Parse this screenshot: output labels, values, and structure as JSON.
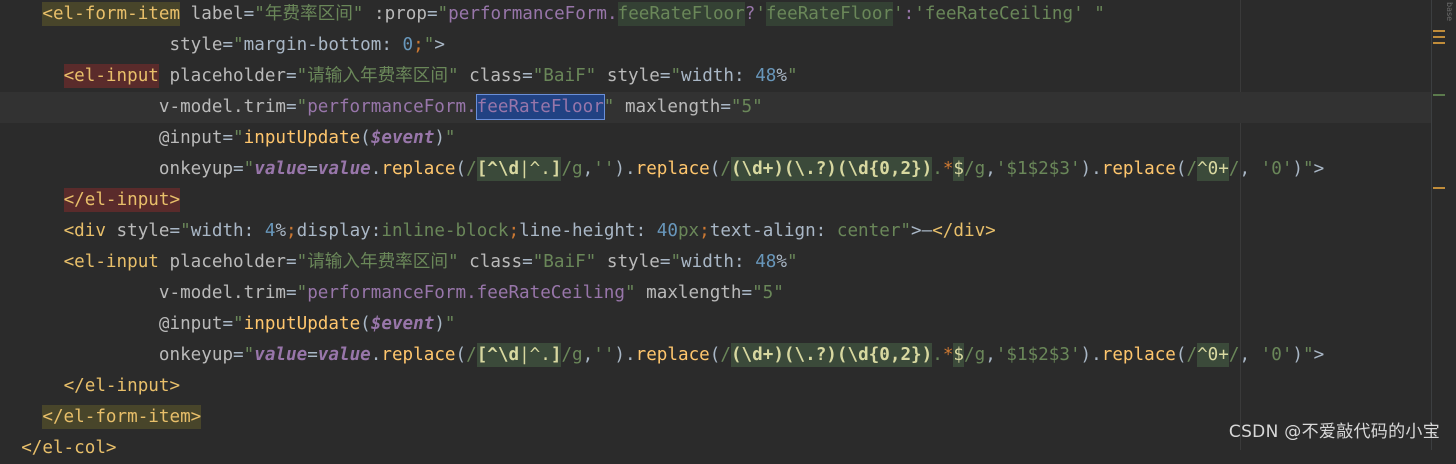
{
  "code_lines": [
    {
      "current": false,
      "tokens": [
        [
          "plain",
          "    "
        ],
        [
          "tag-o",
          "<el-form-item"
        ],
        [
          "plain",
          " "
        ],
        [
          "attr",
          "label"
        ],
        [
          "plain",
          "="
        ],
        [
          "str",
          "\"年费率区间\""
        ],
        [
          "plain",
          " "
        ],
        [
          "attr",
          ":prop"
        ],
        [
          "plain",
          "="
        ],
        [
          "str",
          "\""
        ],
        [
          "vue",
          "performanceForm."
        ],
        [
          "hl",
          "feeRateFloor"
        ],
        [
          "vue",
          "?"
        ],
        [
          "str",
          "'"
        ],
        [
          "hl",
          "feeRateFloor"
        ],
        [
          "str",
          "'"
        ],
        [
          "vue",
          ":"
        ],
        [
          "str",
          "'feeRateCeiling'"
        ],
        [
          "plain",
          " "
        ],
        [
          "str",
          "\""
        ]
      ]
    },
    {
      "current": false,
      "tokens": [
        [
          "plain",
          "                "
        ],
        [
          "attr",
          "style"
        ],
        [
          "plain",
          "="
        ],
        [
          "str",
          "\""
        ],
        [
          "plain",
          "margin-bottom: "
        ],
        [
          "num",
          "0"
        ],
        [
          "kw",
          ";"
        ],
        [
          "str",
          "\""
        ],
        [
          "plain",
          ">"
        ]
      ]
    },
    {
      "current": false,
      "tokens": [
        [
          "plain",
          "      "
        ],
        [
          "tag-err",
          "<el-input"
        ],
        [
          "plain",
          " "
        ],
        [
          "attr",
          "placeholder"
        ],
        [
          "plain",
          "="
        ],
        [
          "str",
          "\"请输入年费率区间\""
        ],
        [
          "plain",
          " "
        ],
        [
          "attr",
          "class"
        ],
        [
          "plain",
          "="
        ],
        [
          "str",
          "\"BaiF\""
        ],
        [
          "plain",
          " "
        ],
        [
          "attr",
          "style"
        ],
        [
          "plain",
          "="
        ],
        [
          "str",
          "\""
        ],
        [
          "plain",
          "width: "
        ],
        [
          "num",
          "48"
        ],
        [
          "plain",
          "%"
        ],
        [
          "str",
          "\""
        ]
      ]
    },
    {
      "current": true,
      "tokens": [
        [
          "plain",
          "               "
        ],
        [
          "attr",
          "v-model.trim"
        ],
        [
          "plain",
          "="
        ],
        [
          "str",
          "\""
        ],
        [
          "vue",
          "performanceForm."
        ],
        [
          "sel",
          "feeRateFloor"
        ],
        [
          "str",
          "\""
        ],
        [
          "plain",
          " "
        ],
        [
          "attr",
          "maxlength"
        ],
        [
          "plain",
          "="
        ],
        [
          "str",
          "\"5\""
        ]
      ]
    },
    {
      "current": false,
      "tokens": [
        [
          "plain",
          "               "
        ],
        [
          "attr",
          "@input"
        ],
        [
          "plain",
          "="
        ],
        [
          "str",
          "\""
        ],
        [
          "fn",
          "inputUpdate"
        ],
        [
          "plain",
          "("
        ],
        [
          "ital",
          "$event"
        ],
        [
          "plain",
          ")"
        ],
        [
          "str",
          "\""
        ]
      ]
    },
    {
      "current": false,
      "tokens": [
        [
          "plain",
          "               "
        ],
        [
          "attr",
          "onkeyup"
        ],
        [
          "plain",
          "="
        ],
        [
          "str",
          "\""
        ],
        [
          "ital",
          "value"
        ],
        [
          "plain",
          "="
        ],
        [
          "ital",
          "value"
        ],
        [
          "plain",
          "."
        ],
        [
          "fn",
          "replace"
        ],
        [
          "plain",
          "("
        ],
        [
          "rx",
          "/"
        ],
        [
          "rxb",
          "[^\\d"
        ],
        [
          "rxg",
          "|^."
        ],
        [
          "rxb",
          "]"
        ],
        [
          "rx",
          "/g"
        ],
        [
          "plain",
          ","
        ],
        [
          "str",
          "''"
        ],
        [
          "plain",
          ")."
        ],
        [
          "fn",
          "replace"
        ],
        [
          "plain",
          "("
        ],
        [
          "rx",
          "/"
        ],
        [
          "rxb",
          "(\\d+)"
        ],
        [
          "rxb",
          "(\\.?)"
        ],
        [
          "rxb",
          "(\\d{0,2})"
        ],
        [
          "rx",
          "."
        ],
        [
          "esc",
          "*"
        ],
        [
          "rxg",
          "$"
        ],
        [
          "rx",
          "/g"
        ],
        [
          "plain",
          ","
        ],
        [
          "str",
          "'$1$2$3'"
        ],
        [
          "plain",
          ")."
        ],
        [
          "fn",
          "replace"
        ],
        [
          "plain",
          "("
        ],
        [
          "rx",
          "/"
        ],
        [
          "rxg",
          "^0+"
        ],
        [
          "rx",
          "/"
        ],
        [
          "plain",
          ", "
        ],
        [
          "str",
          "'0'"
        ],
        [
          "plain",
          ")"
        ],
        [
          "str",
          "\""
        ],
        [
          "plain",
          ">"
        ]
      ]
    },
    {
      "current": false,
      "tokens": [
        [
          "plain",
          "      "
        ],
        [
          "tag-err",
          "</el-input>"
        ]
      ]
    },
    {
      "current": false,
      "tokens": [
        [
          "plain",
          "      "
        ],
        [
          "tag",
          "<div"
        ],
        [
          "plain",
          " "
        ],
        [
          "attr",
          "style"
        ],
        [
          "plain",
          "="
        ],
        [
          "str",
          "\""
        ],
        [
          "plain",
          "width: "
        ],
        [
          "num",
          "4"
        ],
        [
          "plain",
          "%"
        ],
        [
          "kw",
          ";"
        ],
        [
          "plain",
          "display:"
        ],
        [
          "str",
          "inline-block"
        ],
        [
          "kw",
          ";"
        ],
        [
          "plain",
          "line-height: "
        ],
        [
          "num",
          "40"
        ],
        [
          "str",
          "px"
        ],
        [
          "kw",
          ";"
        ],
        [
          "plain",
          "text-align: "
        ],
        [
          "str",
          "center"
        ],
        [
          "str",
          "\""
        ],
        [
          "plain",
          ">—"
        ],
        [
          "tag",
          "</div>"
        ]
      ]
    },
    {
      "current": false,
      "tokens": [
        [
          "plain",
          "      "
        ],
        [
          "tag",
          "<el-input"
        ],
        [
          "plain",
          " "
        ],
        [
          "attr",
          "placeholder"
        ],
        [
          "plain",
          "="
        ],
        [
          "str",
          "\"请输入年费率区间\""
        ],
        [
          "plain",
          " "
        ],
        [
          "attr",
          "class"
        ],
        [
          "plain",
          "="
        ],
        [
          "str",
          "\"BaiF\""
        ],
        [
          "plain",
          " "
        ],
        [
          "attr",
          "style"
        ],
        [
          "plain",
          "="
        ],
        [
          "str",
          "\""
        ],
        [
          "plain",
          "width: "
        ],
        [
          "num",
          "48"
        ],
        [
          "plain",
          "%"
        ],
        [
          "str",
          "\""
        ]
      ]
    },
    {
      "current": false,
      "tokens": [
        [
          "plain",
          "               "
        ],
        [
          "attr",
          "v-model.trim"
        ],
        [
          "plain",
          "="
        ],
        [
          "str",
          "\""
        ],
        [
          "vue",
          "performanceForm.feeRateCeiling"
        ],
        [
          "str",
          "\""
        ],
        [
          "plain",
          " "
        ],
        [
          "attr",
          "maxlength"
        ],
        [
          "plain",
          "="
        ],
        [
          "str",
          "\"5\""
        ]
      ]
    },
    {
      "current": false,
      "tokens": [
        [
          "plain",
          "               "
        ],
        [
          "attr",
          "@input"
        ],
        [
          "plain",
          "="
        ],
        [
          "str",
          "\""
        ],
        [
          "fn",
          "inputUpdate"
        ],
        [
          "plain",
          "("
        ],
        [
          "ital",
          "$event"
        ],
        [
          "plain",
          ")"
        ],
        [
          "str",
          "\""
        ]
      ]
    },
    {
      "current": false,
      "tokens": [
        [
          "plain",
          "               "
        ],
        [
          "attr",
          "onkeyup"
        ],
        [
          "plain",
          "="
        ],
        [
          "str",
          "\""
        ],
        [
          "ital",
          "value"
        ],
        [
          "plain",
          "="
        ],
        [
          "ital",
          "value"
        ],
        [
          "plain",
          "."
        ],
        [
          "fn",
          "replace"
        ],
        [
          "plain",
          "("
        ],
        [
          "rx",
          "/"
        ],
        [
          "rxb",
          "[^\\d"
        ],
        [
          "rxg",
          "|^."
        ],
        [
          "rxb",
          "]"
        ],
        [
          "rx",
          "/g"
        ],
        [
          "plain",
          ","
        ],
        [
          "str",
          "''"
        ],
        [
          "plain",
          ")."
        ],
        [
          "fn",
          "replace"
        ],
        [
          "plain",
          "("
        ],
        [
          "rx",
          "/"
        ],
        [
          "rxb",
          "(\\d+)"
        ],
        [
          "rxb",
          "(\\.?)"
        ],
        [
          "rxb",
          "(\\d{0,2})"
        ],
        [
          "rx",
          "."
        ],
        [
          "esc",
          "*"
        ],
        [
          "rxg",
          "$"
        ],
        [
          "rx",
          "/g"
        ],
        [
          "plain",
          ","
        ],
        [
          "str",
          "'$1$2$3'"
        ],
        [
          "plain",
          ")."
        ],
        [
          "fn",
          "replace"
        ],
        [
          "plain",
          "("
        ],
        [
          "rx",
          "/"
        ],
        [
          "rxg",
          "^0+"
        ],
        [
          "rx",
          "/"
        ],
        [
          "plain",
          ", "
        ],
        [
          "str",
          "'0'"
        ],
        [
          "plain",
          ")"
        ],
        [
          "str",
          "\""
        ],
        [
          "plain",
          ">"
        ]
      ]
    },
    {
      "current": false,
      "tokens": [
        [
          "plain",
          "      "
        ],
        [
          "tag",
          "</el-input>"
        ]
      ]
    },
    {
      "current": false,
      "tokens": [
        [
          "plain",
          "    "
        ],
        [
          "tag-o",
          "</el-form-item>"
        ]
      ]
    },
    {
      "current": false,
      "tokens": [
        [
          "plain",
          "  "
        ],
        [
          "tag",
          "</el-col>"
        ]
      ]
    }
  ],
  "watermark": "CSDN @不爱敲代码的小宝",
  "side_label": "base",
  "colors": {
    "background": "#2b2b2b",
    "tag": "#e8bf6a",
    "string": "#6a8759",
    "vue_expr": "#9876aa",
    "function": "#ffc66d",
    "keyword": "#cc7832",
    "number": "#6897bb"
  }
}
